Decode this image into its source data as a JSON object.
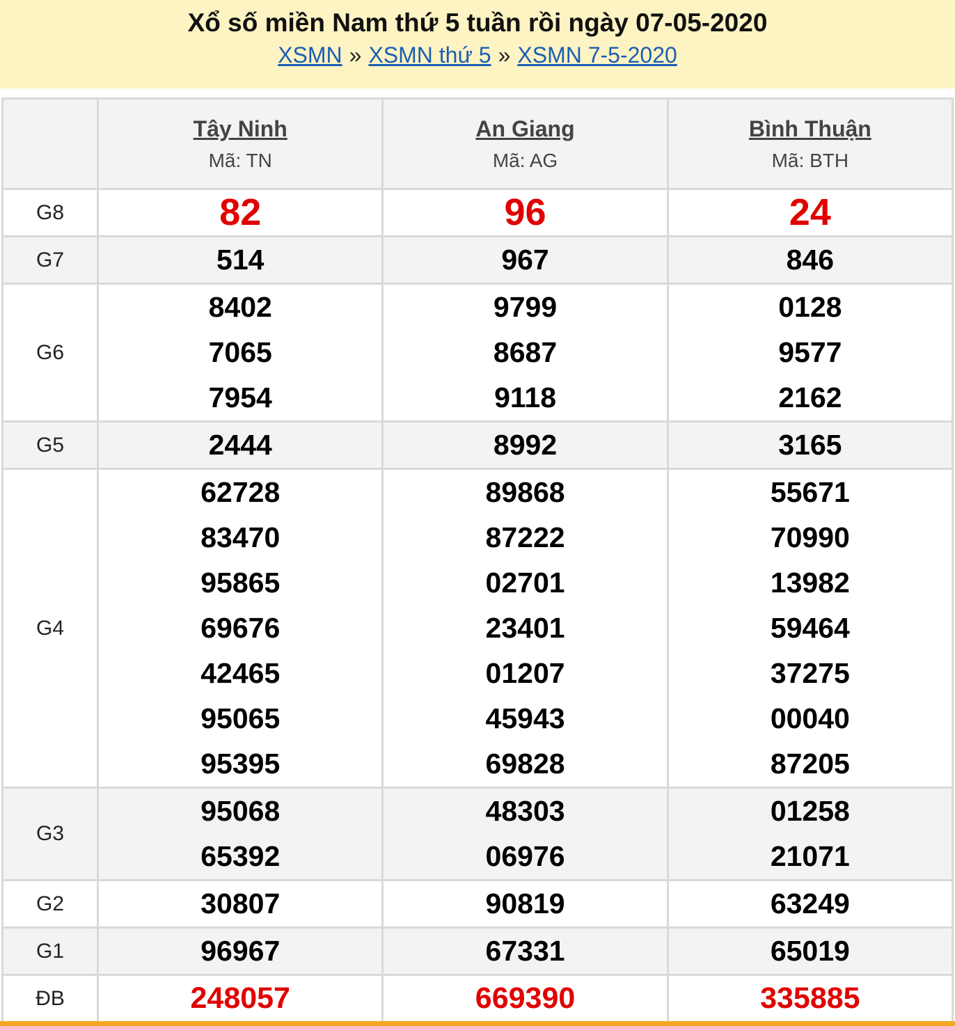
{
  "header": {
    "title": "Xổ số miền Nam thứ 5 tuần rồi ngày 07-05-2020",
    "breadcrumb": [
      {
        "label": "XSMN"
      },
      {
        "label": "XSMN thứ 5"
      },
      {
        "label": "XSMN 7-5-2020"
      }
    ],
    "separator": "»"
  },
  "provinces": [
    {
      "name": "Tây Ninh",
      "code": "Mã: TN"
    },
    {
      "name": "An Giang",
      "code": "Mã: AG"
    },
    {
      "name": "Bình Thuận",
      "code": "Mã: BTH"
    }
  ],
  "prizes": {
    "g8": {
      "label": "G8",
      "values": [
        [
          "82"
        ],
        [
          "96"
        ],
        [
          "24"
        ]
      ]
    },
    "g7": {
      "label": "G7",
      "values": [
        [
          "514"
        ],
        [
          "967"
        ],
        [
          "846"
        ]
      ]
    },
    "g6": {
      "label": "G6",
      "values": [
        [
          "8402",
          "7065",
          "7954"
        ],
        [
          "9799",
          "8687",
          "9118"
        ],
        [
          "0128",
          "9577",
          "2162"
        ]
      ]
    },
    "g5": {
      "label": "G5",
      "values": [
        [
          "2444"
        ],
        [
          "8992"
        ],
        [
          "3165"
        ]
      ]
    },
    "g4": {
      "label": "G4",
      "values": [
        [
          "62728",
          "83470",
          "95865",
          "69676",
          "42465",
          "95065",
          "95395"
        ],
        [
          "89868",
          "87222",
          "02701",
          "23401",
          "01207",
          "45943",
          "69828"
        ],
        [
          "55671",
          "70990",
          "13982",
          "59464",
          "37275",
          "00040",
          "87205"
        ]
      ]
    },
    "g3": {
      "label": "G3",
      "values": [
        [
          "95068",
          "65392"
        ],
        [
          "48303",
          "06976"
        ],
        [
          "01258",
          "21071"
        ]
      ]
    },
    "g2": {
      "label": "G2",
      "values": [
        [
          "30807"
        ],
        [
          "90819"
        ],
        [
          "63249"
        ]
      ]
    },
    "g1": {
      "label": "G1",
      "values": [
        [
          "96967"
        ],
        [
          "67331"
        ],
        [
          "65019"
        ]
      ]
    },
    "db": {
      "label": "ĐB",
      "values": [
        [
          "248057"
        ],
        [
          "669390"
        ],
        [
          "335885"
        ]
      ]
    }
  },
  "colors": {
    "header_bg": "#fdf3c3",
    "link": "#1a5fb4",
    "highlight": "#e00000",
    "bottom_bar": "#f5a623"
  }
}
